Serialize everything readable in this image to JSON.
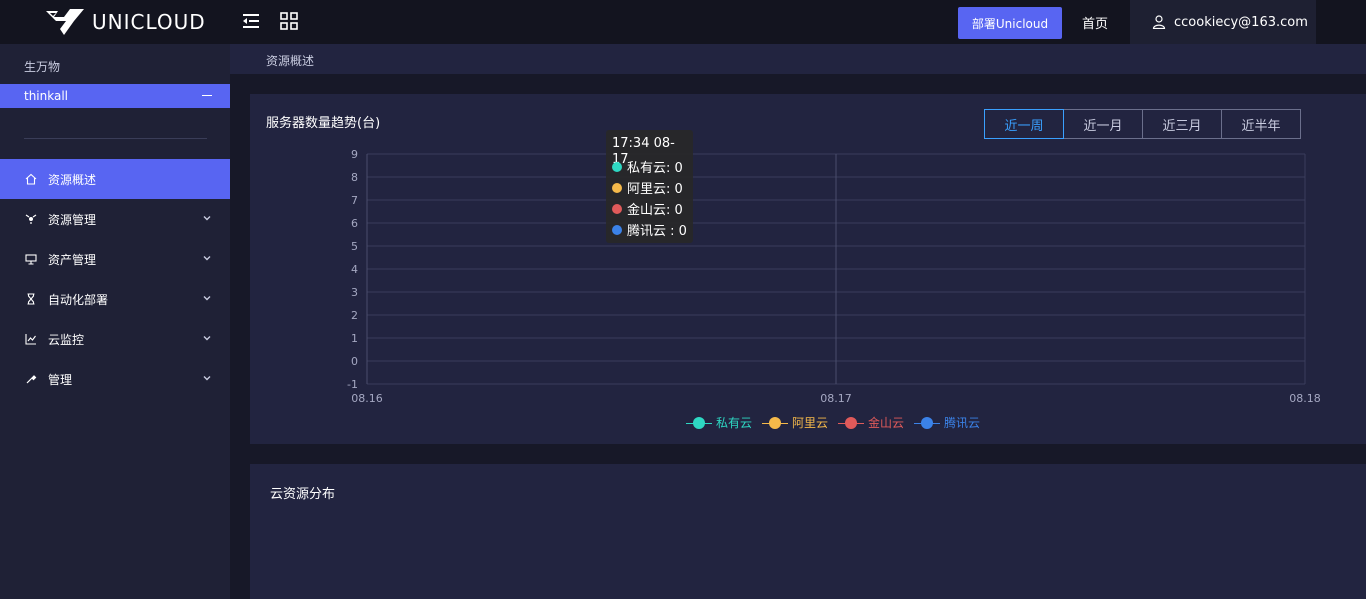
{
  "header": {
    "logo_text": "UNICLOUD",
    "deploy_label": "部署Unicloud",
    "home_label": "首页",
    "user_email": "ccookiecy@163.com"
  },
  "sidebar": {
    "org_name": "生万物",
    "project_name": "thinkall",
    "items": [
      {
        "label": "资源概述",
        "icon": "home-icon",
        "active": true
      },
      {
        "label": "资源管理",
        "icon": "resource-icon"
      },
      {
        "label": "资产管理",
        "icon": "monitor-icon"
      },
      {
        "label": "自动化部署",
        "icon": "hourglass-icon"
      },
      {
        "label": "云监控",
        "icon": "chart-line-icon"
      },
      {
        "label": "管理",
        "icon": "tools-icon"
      }
    ]
  },
  "breadcrumb": "资源概述",
  "server_panel": {
    "title": "服务器数量趋势(台)",
    "ranges": [
      "近一周",
      "近一月",
      "近三月",
      "近半年"
    ],
    "active_range": "近一周"
  },
  "tooltip": {
    "time": "17:34 08-17",
    "rows": [
      {
        "label": "私有云: 0",
        "color": "#2ed8c3"
      },
      {
        "label": "阿里云: 0",
        "color": "#f5b94a"
      },
      {
        "label": "金山云: 0",
        "color": "#e05a5a"
      },
      {
        "label": "腾讯云 : 0",
        "color": "#3b82e8"
      }
    ]
  },
  "chart_data": {
    "type": "line",
    "x": [
      "08.16",
      "08.17",
      "08.18"
    ],
    "ylim": [
      -1,
      9
    ],
    "yticks": [
      "9",
      "8",
      "7",
      "6",
      "5",
      "4",
      "3",
      "2",
      "1",
      "0",
      "-1"
    ],
    "grid": true,
    "legend_position": "bottom",
    "series": [
      {
        "name": "私有云",
        "color": "#2ed8c3",
        "values": []
      },
      {
        "name": "阿里云",
        "color": "#f5b94a",
        "values": []
      },
      {
        "name": "金山云",
        "color": "#e05a5a",
        "values": []
      },
      {
        "name": "腾讯云",
        "color": "#3b82e8",
        "values": []
      }
    ]
  },
  "distribution_panel": {
    "title": "云资源分布"
  }
}
